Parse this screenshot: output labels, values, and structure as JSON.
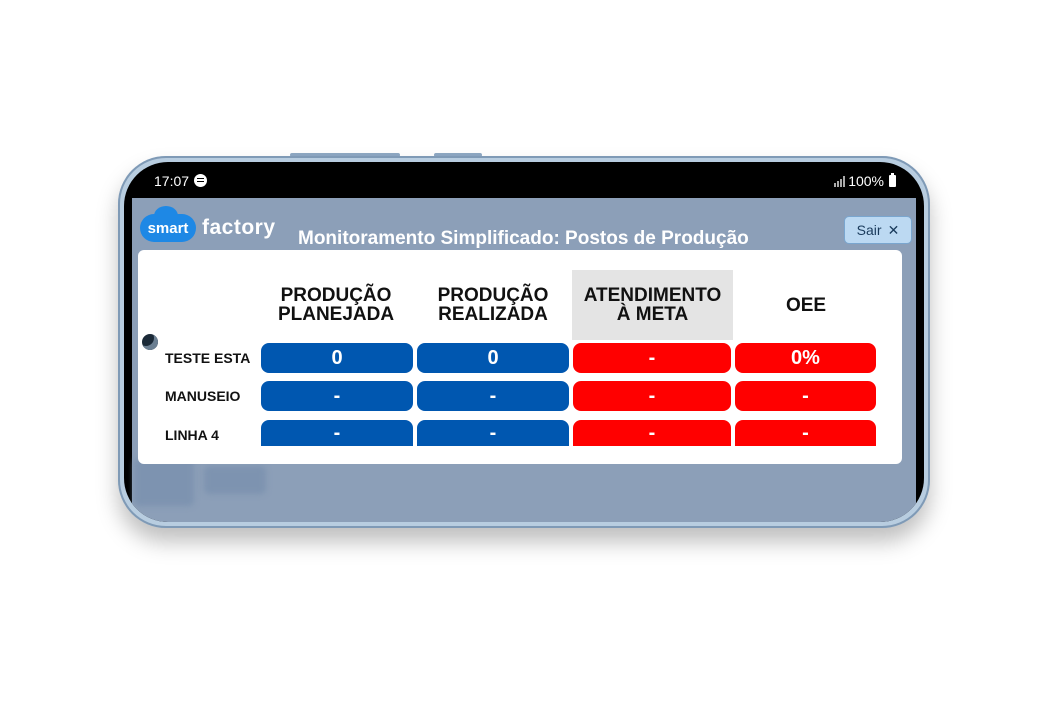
{
  "status_bar": {
    "time": "17:07",
    "battery": "100%"
  },
  "app": {
    "logo_smart": "smart",
    "logo_factory": "factory",
    "title": "Monitoramento Simplificado: Postos de Produção",
    "sair_label": "Sair",
    "colors": {
      "blue": "#0057b0",
      "red": "#ff0000",
      "header_bg": "#8c9fb8"
    }
  },
  "table": {
    "headers": {
      "planejada_1": "PRODUÇÃO",
      "planejada_2": "PLANEJADA",
      "realizada_1": "PRODUÇÃO",
      "realizada_2": "REALIZADA",
      "meta_1": "ATENDIMENTO",
      "meta_2": "À META",
      "oee": "OEE"
    },
    "rows": [
      {
        "label": "TESTE ESTA",
        "planejada": "0",
        "realizada": "0",
        "meta": "-",
        "oee": "0%"
      },
      {
        "label": "MANUSEIO",
        "planejada": "-",
        "realizada": "-",
        "meta": "-",
        "oee": "-"
      },
      {
        "label": "LINHA 4",
        "planejada": "-",
        "realizada": "-",
        "meta": "-",
        "oee": "-"
      }
    ]
  }
}
